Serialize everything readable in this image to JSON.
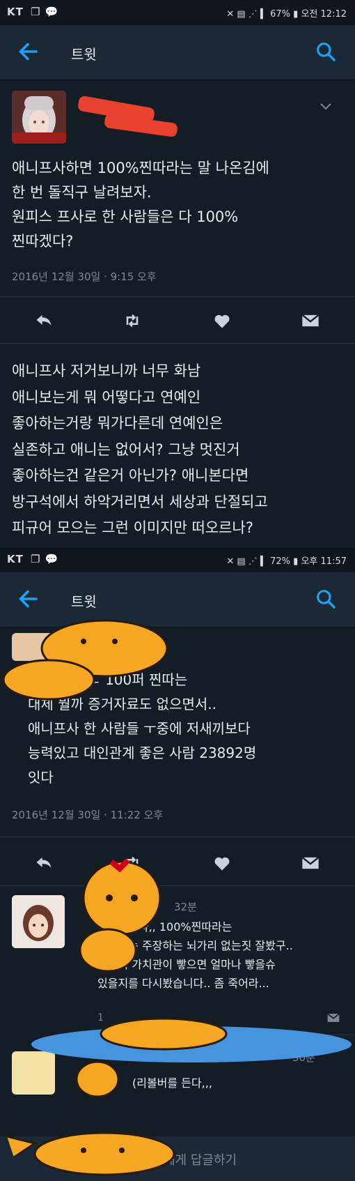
{
  "status_bar_1": {
    "carrier": "KT",
    "battery": "67%",
    "time": "오전 12:12"
  },
  "status_bar_2": {
    "carrier": "KT",
    "battery": "72%",
    "time": "오후 11:57"
  },
  "screen1": {
    "title": "트윗",
    "tweet_text": "애니프사하면 100%찐따라는 말 나온김에\n한 번 돌직구 날려보자.\n원피스 프사로 한 사람들은 다 100%\n찐따겠다?",
    "timestamp": "2016년 12월 30일 · 9:15 오후",
    "reply_text": "애니프사 저거보니까 너무 화남\n애니보는게 뭐 어떻다고 연예인\n좋아하는거랑 뭐가다른데 연예인은\n실존하고 애니는 없어서? 그냥 멋진거\n좋아하는건 같은거 아닌가? 애니본다면\n방구석에서 하악거리면서 세상과 단절되고\n피규어 모으는 그런 이미지만 떠오르나?"
  },
  "screen2": {
    "title": "트윗",
    "tweet_text": "ㅠㅜ 아 ㅈㄴ 100퍼 찐따는\n대체 뭘까 증거자료도 없으면서..\n애니프사 한 사람들 ㅜ중에 저새끼보다\n능력있고 대인관계 좋은 사람 23892명\n잇다",
    "timestamp": "2016년 12월 30일 · 11:22 오후",
    "reply1": {
      "time": "32분",
      "text": "인정합니다,, 100%찐따라는\n근거없는 주장하는 뇌가리 없는짓 잘봤구..\n사람의 가치관이 빻으면 얼마나 빻을슈\n있을지를 다시봤습니다.. 좀 죽어라...",
      "reply_count": "1"
    },
    "reply2": {
      "time": "30분",
      "text": "(리볼버를 든다,,,"
    },
    "reply_placeholder": "에게 답글하기"
  },
  "colors": {
    "background": "#141d26",
    "toolbar": "#1b2836",
    "accent": "#1da1f2",
    "muted": "#7d8a96",
    "redaction": "#e8412e",
    "sticker": "#f5a623"
  }
}
